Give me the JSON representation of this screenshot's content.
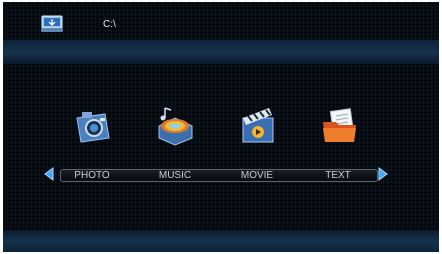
{
  "header": {
    "drive_icon": "drive-icon",
    "path": "C:\\"
  },
  "menu": {
    "items": [
      {
        "label": "PHOTO",
        "icon": "camera-icon"
      },
      {
        "label": "MUSIC",
        "icon": "music-disc-icon"
      },
      {
        "label": "MOVIE",
        "icon": "clapperboard-icon"
      },
      {
        "label": "TEXT",
        "icon": "document-folder-icon"
      }
    ],
    "left_arrow_icon": "arrow-left-icon",
    "right_arrow_icon": "arrow-right-icon"
  },
  "colors": {
    "background": "#04070c",
    "band": "#17324f",
    "arrow": "#3fa9f5",
    "text": "#c8ccd2"
  }
}
